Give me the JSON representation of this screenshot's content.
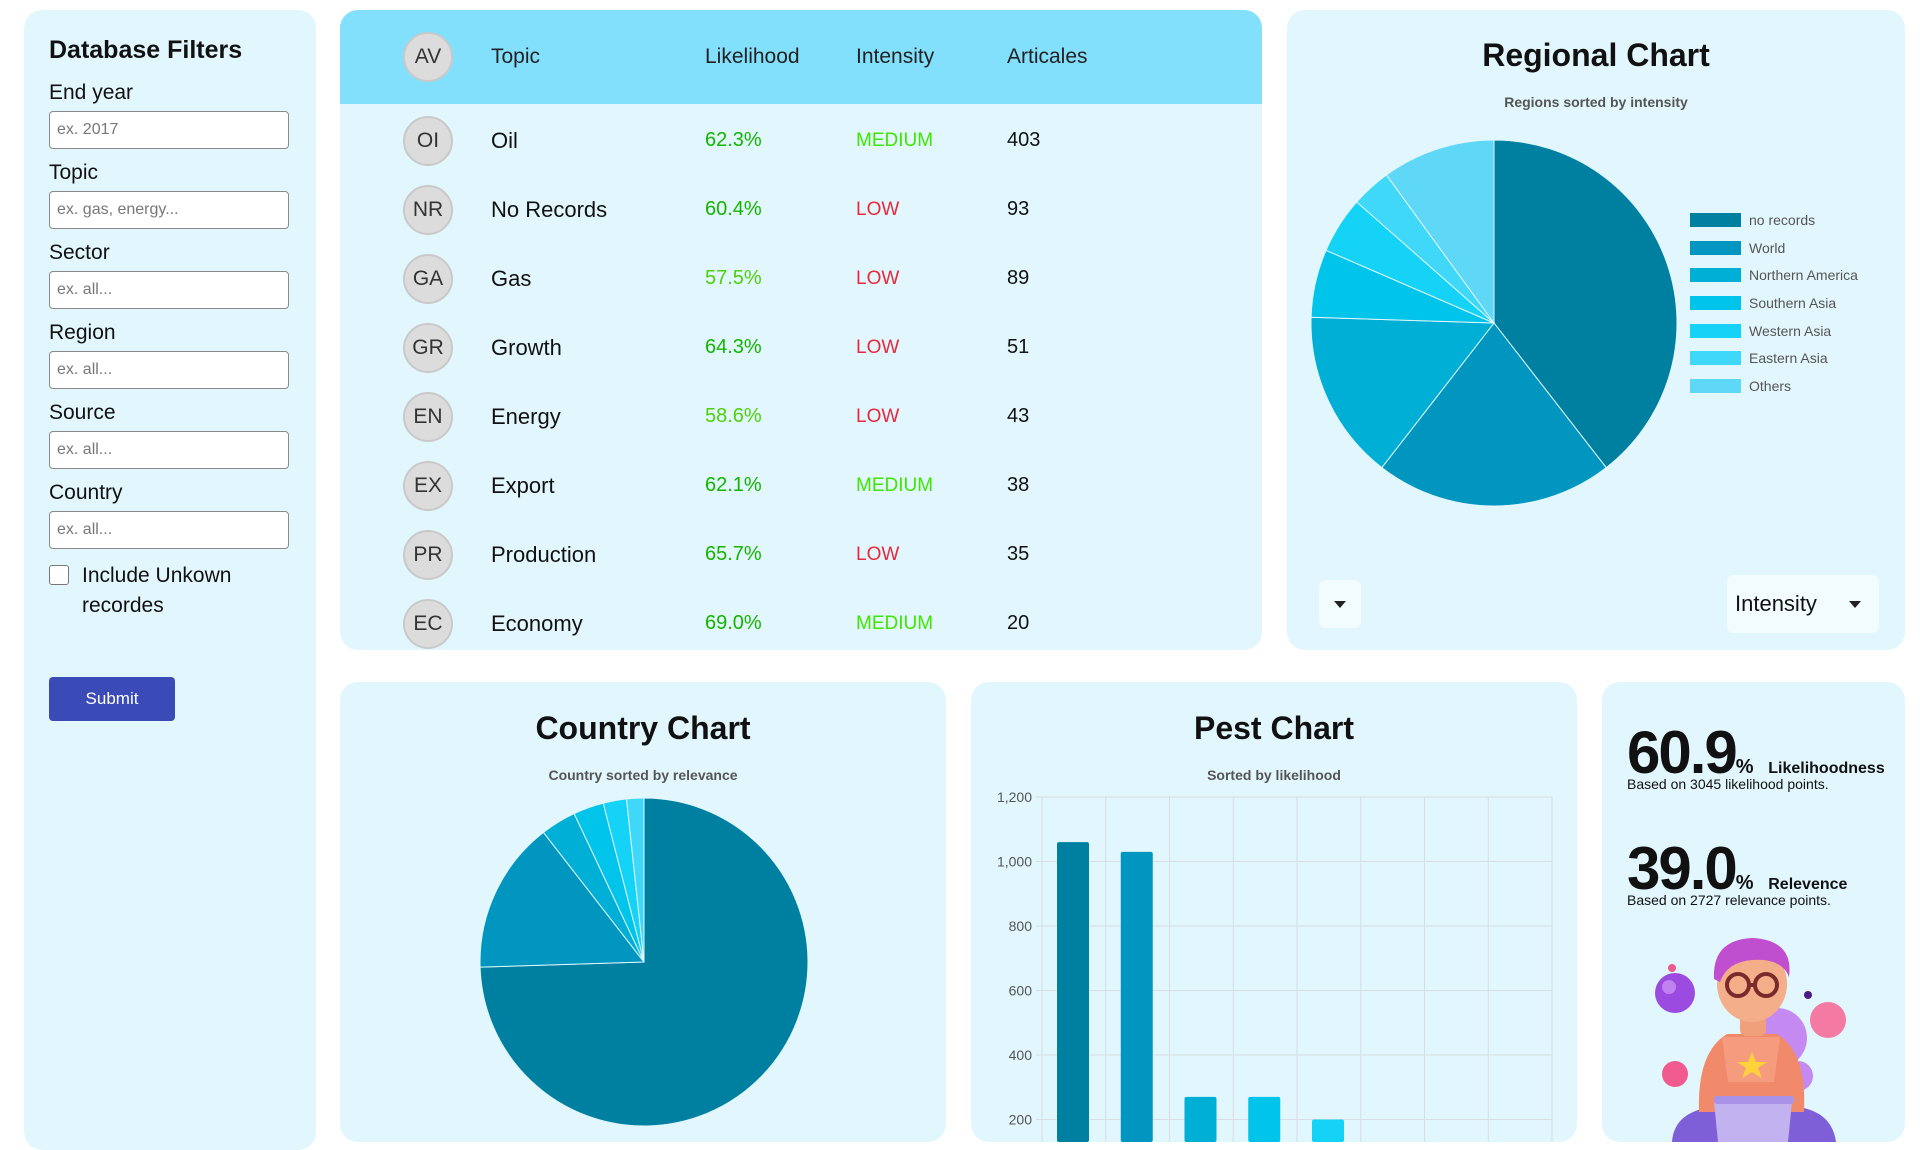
{
  "filters": {
    "title": "Database Filters",
    "fields": [
      {
        "label": "End year",
        "placeholder": "ex. 2017"
      },
      {
        "label": "Topic",
        "placeholder": "ex. gas, energy..."
      },
      {
        "label": "Sector",
        "placeholder": "ex. all..."
      },
      {
        "label": "Region",
        "placeholder": "ex. all..."
      },
      {
        "label": "Source",
        "placeholder": "ex. all..."
      },
      {
        "label": "Country",
        "placeholder": "ex. all..."
      }
    ],
    "include_unknown_label": "Include Unkown recordes",
    "include_unknown_checked": false,
    "submit_label": "Submit"
  },
  "topics_table": {
    "headers": {
      "avatar": "AV",
      "topic": "Topic",
      "likelihood": "Likelihood",
      "intensity": "Intensity",
      "articles": "Articales"
    },
    "rows": [
      {
        "avatar": "OI",
        "topic": "Oil",
        "likelihood": "62.3%",
        "intensity": "MEDIUM",
        "articles": "403"
      },
      {
        "avatar": "NR",
        "topic": "No Records",
        "likelihood": "60.4%",
        "intensity": "LOW",
        "articles": "93"
      },
      {
        "avatar": "GA",
        "topic": "Gas",
        "likelihood": "57.5%",
        "intensity": "LOW",
        "articles": "89"
      },
      {
        "avatar": "GR",
        "topic": "Growth",
        "likelihood": "64.3%",
        "intensity": "LOW",
        "articles": "51"
      },
      {
        "avatar": "EN",
        "topic": "Energy",
        "likelihood": "58.6%",
        "intensity": "LOW",
        "articles": "43"
      },
      {
        "avatar": "EX",
        "topic": "Export",
        "likelihood": "62.1%",
        "intensity": "MEDIUM",
        "articles": "38"
      },
      {
        "avatar": "PR",
        "topic": "Production",
        "likelihood": "65.7%",
        "intensity": "LOW",
        "articles": "35"
      },
      {
        "avatar": "EC",
        "topic": "Economy",
        "likelihood": "69.0%",
        "intensity": "MEDIUM",
        "articles": "20"
      }
    ],
    "colors": {
      "low": "#e8283c",
      "medium": "#3ee600",
      "likelihood_strong": "#15b400",
      "likelihood_light": "#4ed00c"
    }
  },
  "regional": {
    "title": "Regional Chart",
    "subtitle": "Regions sorted by intensity",
    "dropdown_value": "Intensity",
    "caret_icon": "caret-down-icon"
  },
  "country": {
    "title": "Country Chart",
    "subtitle": "Country sorted by relevance"
  },
  "pest": {
    "title": "Pest Chart",
    "subtitle": "Sorted by likelihood"
  },
  "stats": {
    "likelihood_value": "60.9",
    "likelihood_pct": "%",
    "likelihood_label": "Likelihoodness",
    "likelihood_based": "Based on 3045 likelihood points.",
    "relevance_value": "39.0",
    "relevance_pct": "%",
    "relevance_label": "Relevence",
    "relevance_based": "Based on 2727 relevance points."
  },
  "chart_data": [
    {
      "type": "pie",
      "title": "Regional Chart",
      "subtitle": "Regions sorted by intensity",
      "categories": [
        "no records",
        "World",
        "Northern America",
        "Southern Asia",
        "Western Asia",
        "Eastern Asia",
        "Others"
      ],
      "values": [
        39.5,
        21,
        15,
        6,
        5,
        3.5,
        10
      ],
      "colors": [
        "#0080a0",
        "#0096bf",
        "#00afd6",
        "#00c4ea",
        "#14d3f7",
        "#3fd8f8",
        "#5fd7f6"
      ],
      "legend": "right"
    },
    {
      "type": "pie",
      "title": "Country Chart",
      "subtitle": "Country sorted by relevance",
      "categories": [
        "",
        "",
        "",
        "",
        "",
        ""
      ],
      "values": [
        74.5,
        15,
        3.5,
        3,
        2.3,
        1.7
      ],
      "colors": [
        "#0080a0",
        "#0096bf",
        "#00afd6",
        "#00c4ea",
        "#14d3f7",
        "#3fd8f8"
      ]
    },
    {
      "type": "bar",
      "title": "Pest Chart",
      "subtitle": "Sorted by likelihood",
      "categories": [
        "",
        "",
        "",
        "",
        "",
        "",
        "",
        ""
      ],
      "values": [
        1060,
        1030,
        270,
        270,
        200,
        0,
        0,
        0
      ],
      "colors": [
        "#0080a0",
        "#0096bf",
        "#00afd6",
        "#00c4ea",
        "#14d3f7",
        "#3fd8f8",
        "#5fd7f6",
        "#5fd7f6"
      ],
      "ylim": [
        0,
        1200
      ],
      "yticks": [
        "200",
        "400",
        "600",
        "800",
        "1,000",
        "1,200"
      ],
      "grid": true
    }
  ]
}
